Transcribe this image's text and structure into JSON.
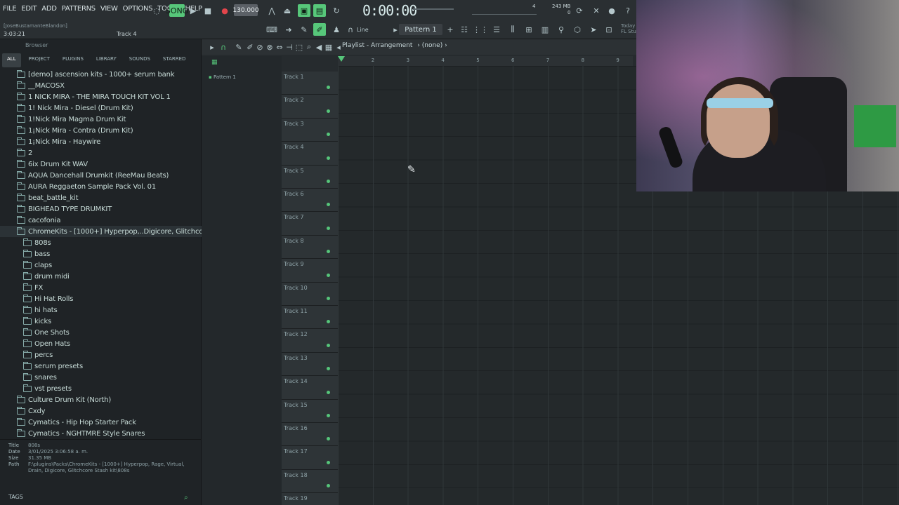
{
  "menu": [
    "FILE",
    "EDIT",
    "ADD",
    "PATTERNS",
    "VIEW",
    "OPTIONS",
    "TOOLS",
    "HELP"
  ],
  "hint_user": "[JoseBustamanteBlandon]",
  "hint_time": "3:03:21",
  "hint_track": "Track 4",
  "tempo": "130.000",
  "time": "0:00:00",
  "time_unit": "M:S:CS",
  "memory": "243 MB",
  "memory_sub": "0",
  "cpu": "4",
  "today_line1": "Today",
  "today_line2": "FL Stu",
  "pattern_selector": "Pattern 1",
  "snap_label": "Line",
  "browser": {
    "header": "Browser",
    "tabs": [
      "ALL",
      "PROJECT",
      "PLUGINS",
      "LIBRARY",
      "SOUNDS",
      "STARRED"
    ],
    "items": [
      {
        "label": "[demo] ascension kits - 1000+ serum bank",
        "level": 0
      },
      {
        "label": "__MACOSX",
        "level": 0
      },
      {
        "label": "1 NICK MIRA - THE MIRA TOUCH KIT VOL 1",
        "level": 0
      },
      {
        "label": "1! Nick Mira - Diesel (Drum Kit)",
        "level": 0
      },
      {
        "label": "1!Nick Mira Magma Drum Kit",
        "level": 0
      },
      {
        "label": "1¡Nick Mira - Contra (Drum Kit)",
        "level": 0
      },
      {
        "label": "1¡Nick Mira - Haywire",
        "level": 0
      },
      {
        "label": "2",
        "level": 0
      },
      {
        "label": "6ix Drum Kit WAV",
        "level": 0
      },
      {
        "label": "AQUA Dancehall Drumkit (ReeMau Beats)",
        "level": 0
      },
      {
        "label": "AURA Reggaeton Sample Pack Vol. 01",
        "level": 0
      },
      {
        "label": "beat_battle_kit",
        "level": 0
      },
      {
        "label": "BIGHEAD TYPE DRUMKIT",
        "level": 0
      },
      {
        "label": "cacofonia",
        "level": 0
      },
      {
        "label": "ChromeKits - [1000+] Hyperpop,..Digicore, Glitchcore Stash kit",
        "level": 0,
        "selected": true
      },
      {
        "label": "808s",
        "level": 1
      },
      {
        "label": "bass",
        "level": 1
      },
      {
        "label": "claps",
        "level": 1
      },
      {
        "label": "drum midi",
        "level": 1
      },
      {
        "label": "FX",
        "level": 1
      },
      {
        "label": "Hi Hat Rolls",
        "level": 1
      },
      {
        "label": "hi hats",
        "level": 1
      },
      {
        "label": "kicks",
        "level": 1
      },
      {
        "label": "One Shots",
        "level": 1
      },
      {
        "label": "Open Hats",
        "level": 1
      },
      {
        "label": "percs",
        "level": 1
      },
      {
        "label": "serum presets",
        "level": 1
      },
      {
        "label": "snares",
        "level": 1
      },
      {
        "label": "vst presets",
        "level": 1
      },
      {
        "label": "Culture Drum Kit (North)",
        "level": 0
      },
      {
        "label": "Cxdy",
        "level": 0
      },
      {
        "label": "Cymatics - Hip Hop Starter Pack",
        "level": 0
      },
      {
        "label": "Cymatics - NGHTMRE Style Snares",
        "level": 0
      }
    ],
    "info": {
      "title_key": "Title",
      "title_val": "808s",
      "date_key": "Date",
      "date_val": "3/01/2025 3:06:58 a. m.",
      "size_key": "Size",
      "size_val": "31.35 MB",
      "path_key": "Path",
      "path_val": "F:\\plugins\\Packs\\ChromeKits - [1000+] Hyperpop, Rage, Virtual, Drain, Digicore, Glitchcore Stash kit\\808s"
    },
    "tags_label": "TAGS"
  },
  "playlist": {
    "title": "Playlist - Arrangement",
    "arrangement": "(none)",
    "pattern_item": "Pattern 1",
    "ruler": [
      "2",
      "3",
      "4",
      "5",
      "6",
      "7",
      "8",
      "9"
    ],
    "tracks": [
      "Track 1",
      "Track 2",
      "Track 3",
      "Track 4",
      "Track 5",
      "Track 6",
      "Track 7",
      "Track 8",
      "Track 9",
      "Track 10",
      "Track 11",
      "Track 12",
      "Track 13",
      "Track 14",
      "Track 15",
      "Track 16",
      "Track 17",
      "Track 18",
      "Track 19"
    ]
  },
  "colors": {
    "accent_green": "#56c57a",
    "folder_text": "#c7dbd7",
    "record_red": "#e2454b"
  }
}
